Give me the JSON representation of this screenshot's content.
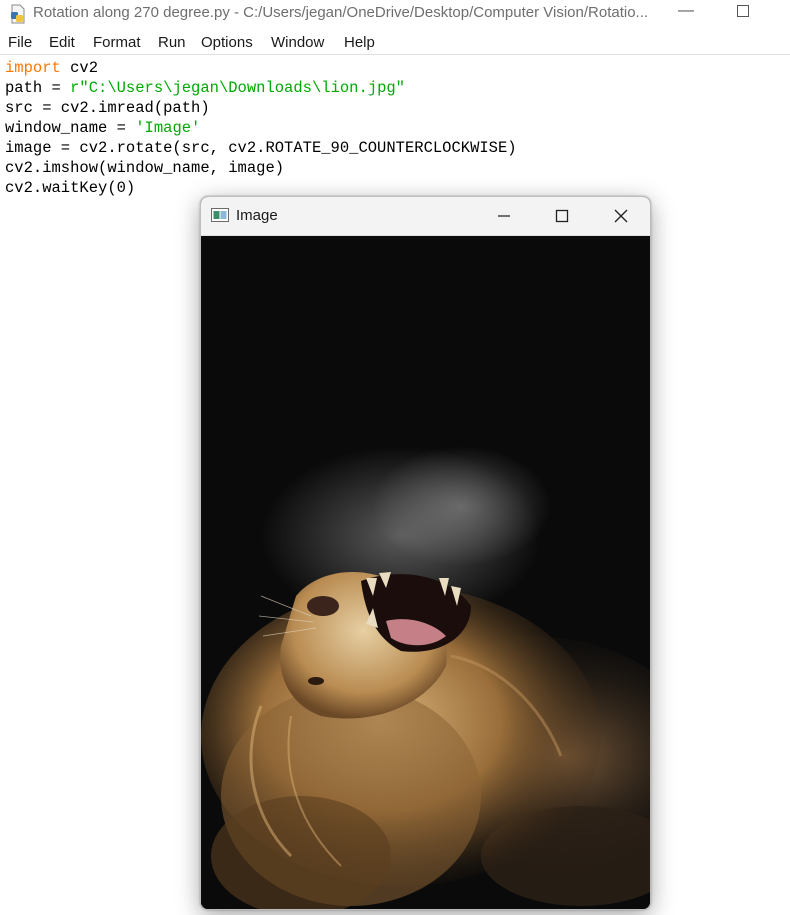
{
  "window": {
    "title": "Rotation along 270 degree.py - C:/Users/jegan/OneDrive/Desktop/Computer Vision/Rotatio..."
  },
  "menu": {
    "items": [
      "File",
      "Edit",
      "Format",
      "Run",
      "Options",
      "Window",
      "Help"
    ]
  },
  "code": {
    "line1": {
      "kw": "import",
      "rest": " cv2"
    },
    "line2": {
      "pre": "path = ",
      "str": "r\"C:\\Users\\jegan\\Downloads\\lion.jpg\""
    },
    "line3": "src = cv2.imread(path)",
    "line4": {
      "pre": "window_name = ",
      "str": "'Image'"
    },
    "line5": "image = cv2.rotate(src, cv2.ROTATE_90_COUNTERCLOCKWISE)",
    "line6": "cv2.imshow(window_name, image)",
    "line7": "cv2.waitKey(0)"
  },
  "image_window": {
    "title": "Image",
    "content_icon": "lion-photo"
  },
  "colors": {
    "keyword": "#ff7700",
    "string": "#00aa00",
    "image_background": "#0a0a0a"
  }
}
